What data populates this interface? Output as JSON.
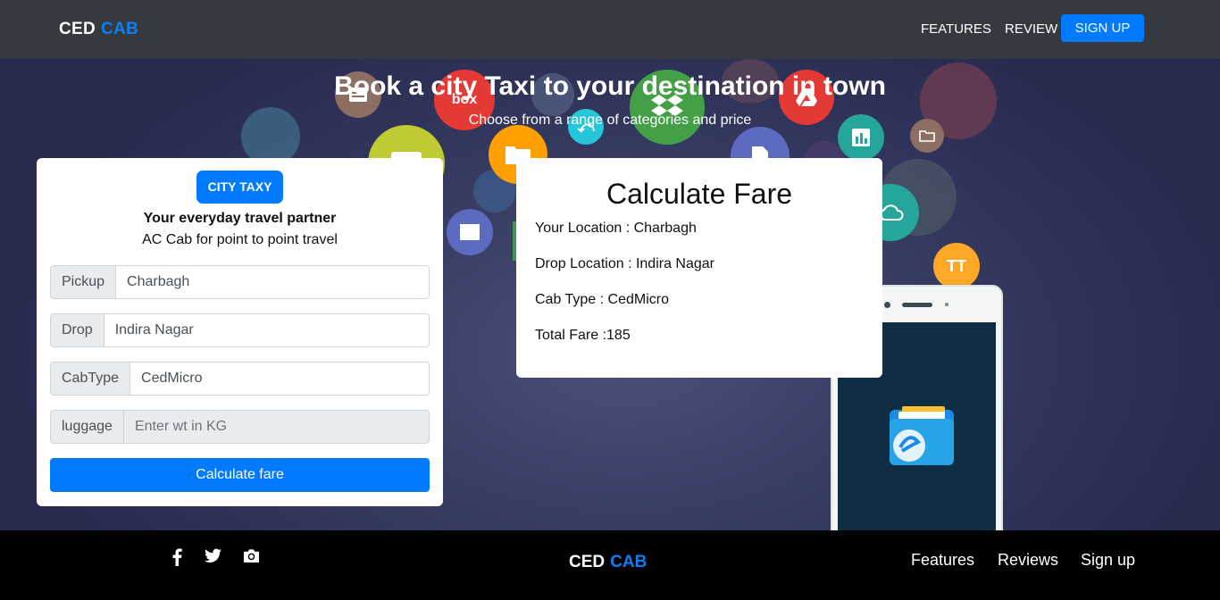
{
  "navbar": {
    "brand_part1": "CED",
    "brand_part2": "CAB",
    "features": "FEATURES",
    "review": "REVIEW",
    "signup": "SIGN UP"
  },
  "hero": {
    "title": "Book a city Taxi to your destination in town",
    "subtitle": "Choose from a range of categories and price"
  },
  "booking": {
    "badge": "CITY TAXY",
    "tagline": "Your everyday travel partner",
    "subtagline": "AC Cab for point to point travel",
    "pickup_label": "Pickup",
    "pickup_value": "Charbagh",
    "drop_label": "Drop",
    "drop_value": "Indira Nagar",
    "cabtype_label": "CabType",
    "cabtype_value": "CedMicro",
    "luggage_label": "luggage",
    "luggage_placeholder": "Enter wt in KG",
    "calculate_label": "Calculate fare"
  },
  "fare": {
    "title": "Calculate Fare",
    "location": "Your Location : Charbagh",
    "drop": "Drop Location : Indira Nagar",
    "cab_type": "Cab Type : CedMicro",
    "total": "Total Fare :185"
  },
  "footer": {
    "brand_part1": "CED",
    "brand_part2": "CAB",
    "features": "Features",
    "reviews": "Reviews",
    "signup": "Sign up"
  },
  "colors": {
    "accent": "#007bff",
    "navbar": "#343a40",
    "footer": "#000000"
  },
  "icons": [
    "facebook-icon",
    "twitter-icon",
    "camera-icon"
  ]
}
